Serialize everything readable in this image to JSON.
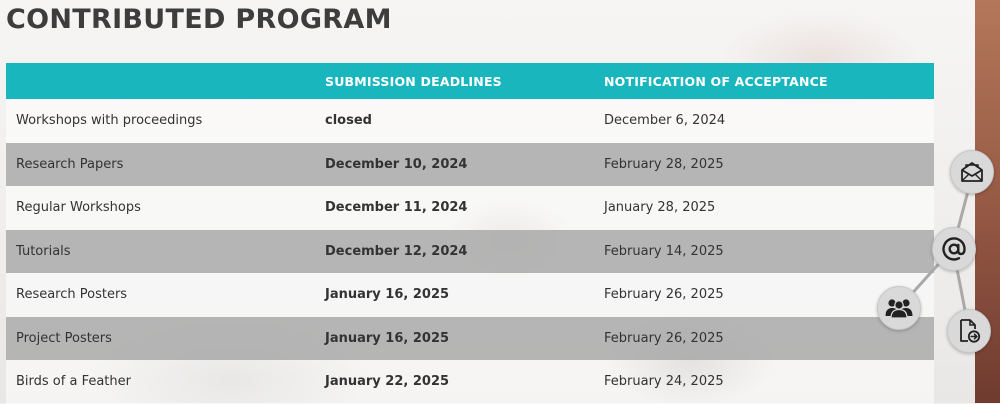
{
  "title": "CONTRIBUTED PROGRAM",
  "table": {
    "headers": [
      "",
      "SUBMISSION DEADLINES",
      "NOTIFICATION OF ACCEPTANCE"
    ],
    "rows": [
      {
        "program": "Workshops with proceedings",
        "deadline": "closed",
        "notification": "December 6, 2024"
      },
      {
        "program": "Research Papers",
        "deadline": "December 10, 2024",
        "notification": "February 28, 2025"
      },
      {
        "program": "Regular Workshops",
        "deadline": "December 11, 2024",
        "notification": "January 28, 2025"
      },
      {
        "program": "Tutorials",
        "deadline": "December 12, 2024",
        "notification": "February 14, 2025"
      },
      {
        "program": "Research Posters",
        "deadline": "January 16, 2025",
        "notification": "February 26, 2025"
      },
      {
        "program": "Project Posters",
        "deadline": "January 16, 2025",
        "notification": "February 26, 2025"
      },
      {
        "program": "Birds of a Feather",
        "deadline": "January 22, 2025",
        "notification": "February 24, 2025"
      }
    ]
  },
  "widget": {
    "icons": [
      "envelope-icon",
      "at-sign-icon",
      "group-icon",
      "document-arrow-icon"
    ]
  },
  "colors": {
    "header_bg": "#1ab6bd",
    "title_text": "#3d3d3d",
    "row_gray": "#b0b0b0"
  }
}
